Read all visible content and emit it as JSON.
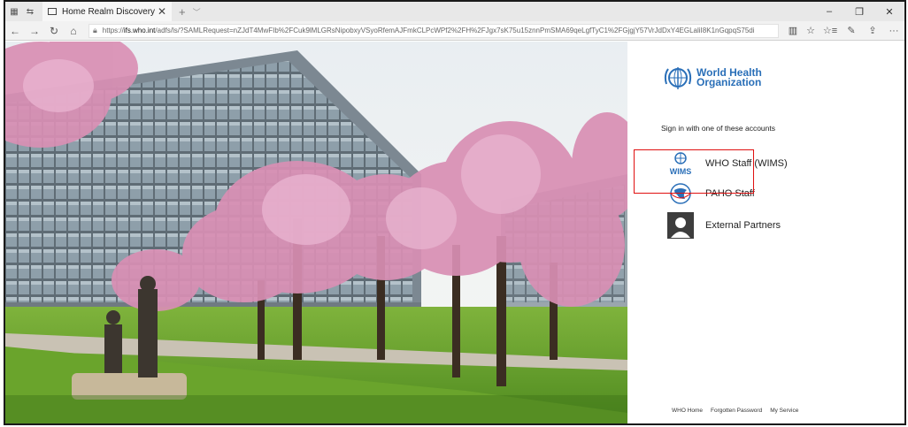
{
  "browser": {
    "tab": {
      "title": "Home Realm Discovery"
    },
    "new_tab_glyph": "+",
    "address": {
      "prefix": "https://",
      "host": "ifs.who.int",
      "path": "/adfs/ls/?SAMLRequest=nZJdT4MwFIb%2FCuk9lMLGRsNipobxyVSyoRfemAJFmkCLPcWPf2%2FH%2FJgx7sK75u15znnPmSMA69qeLgfTyC1%2FGjgjY57VrJdDxY4EGLaliI8K1nGqpqS75di"
    },
    "window_controls": [
      "–",
      "❐",
      "✕"
    ],
    "icons": [
      "back-icon",
      "forward-icon",
      "refresh-icon",
      "home-icon",
      "lock-icon",
      "reading-view-icon",
      "favorite-icon",
      "favorites-hub-icon",
      "pen-icon",
      "share-icon",
      "more-icon"
    ]
  },
  "login_panel": {
    "org_name_line1": "World Health",
    "org_name_line2": "Organization",
    "signin_prompt": "Sign in with one of these accounts",
    "accounts": [
      {
        "label": "WHO Staff (WIMS)",
        "icon": "wims-icon",
        "icon_text": "WIMS"
      },
      {
        "label": "PAHO Staff",
        "icon": "paho-globe-icon"
      },
      {
        "label": "External Partners",
        "icon": "person-silhouette-icon"
      }
    ],
    "footer_links": [
      "WHO Home",
      "Forgotten Password",
      "My Service"
    ]
  },
  "colors": {
    "who_blue": "#2a6fb8",
    "highlight_red": "#e01010"
  }
}
